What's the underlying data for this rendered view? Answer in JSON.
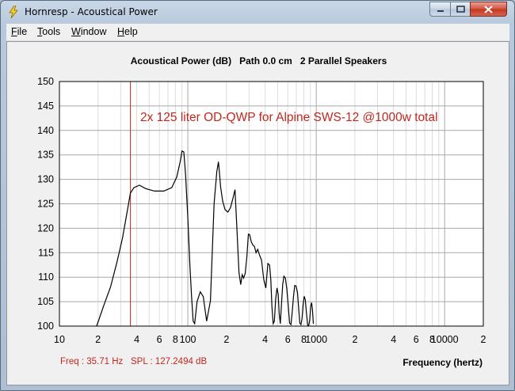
{
  "window": {
    "title": "Hornresp - Acoustical Power",
    "controls": {
      "minimize": "minimize-icon",
      "maximize": "maximize-icon",
      "close": "close-icon"
    }
  },
  "menu": {
    "file": "File",
    "tools": "Tools",
    "window": "Window",
    "help": "Help"
  },
  "header": {
    "quantity": "Acoustical Power (dB)",
    "path": "Path 0.0 cm",
    "speakers": "2 Parallel Speakers"
  },
  "annotation": "2x 125 liter OD-QWP for Alpine SWS-12 @1000w total",
  "status": {
    "freq": "Freq : 35.71 Hz",
    "spl": "SPL : 127.2494 dB",
    "x_axis_label": "Frequency (hertz)"
  },
  "colors": {
    "curve": "#000000",
    "cursor": "#c0281e",
    "annotation": "#c0281e",
    "grid_minor": "#dcdcdc",
    "grid_major": "#a8a8a8"
  },
  "chart_data": {
    "type": "line",
    "xscale": "log",
    "xlim": [
      10,
      20000
    ],
    "ylim": [
      100,
      150
    ],
    "y_ticks": [
      "150",
      "145",
      "140",
      "135",
      "130",
      "125",
      "120",
      "115",
      "110",
      "105",
      "100"
    ],
    "x_ticks": [
      {
        "f": 10,
        "label": "10"
      },
      {
        "f": 20,
        "label": "2"
      },
      {
        "f": 40,
        "label": "4"
      },
      {
        "f": 60,
        "label": "6"
      },
      {
        "f": 80,
        "label": "8"
      },
      {
        "f": 100,
        "label": "100"
      },
      {
        "f": 200,
        "label": "2"
      },
      {
        "f": 400,
        "label": "4"
      },
      {
        "f": 600,
        "label": "6"
      },
      {
        "f": 800,
        "label": "8"
      },
      {
        "f": 1000,
        "label": "1000"
      },
      {
        "f": 2000,
        "label": "2"
      },
      {
        "f": 4000,
        "label": "4"
      },
      {
        "f": 6000,
        "label": "6"
      },
      {
        "f": 8000,
        "label": "8"
      },
      {
        "f": 10000,
        "label": "10000"
      },
      {
        "f": 20000,
        "label": "2"
      }
    ],
    "cursor": {
      "freq": 35.71,
      "spl": 127.2494
    },
    "series": [
      {
        "x": [
          19.5,
          22,
          25,
          28,
          31,
          33,
          35.7,
          38,
          42,
          47,
          55,
          65,
          75,
          82,
          87,
          90,
          93,
          96,
          100,
          104,
          107,
          110,
          113,
          118,
          125,
          132,
          140,
          150,
          160,
          168,
          173,
          176,
          180,
          187,
          195,
          205,
          215,
          225,
          233,
          240,
          250,
          258,
          265,
          272,
          280,
          288,
          296,
          303,
          312,
          322,
          330,
          340,
          350,
          362,
          375,
          390,
          405,
          420,
          433,
          443,
          452,
          462,
          472,
          483,
          495,
          505,
          515,
          525,
          535,
          548,
          560,
          575,
          590,
          605,
          620,
          635,
          650,
          665,
          680,
          697,
          715,
          730,
          745,
          760,
          775,
          790,
          805,
          822,
          840,
          857,
          873,
          890,
          905,
          920,
          935,
          950
        ],
        "y": [
          100,
          104,
          108,
          113,
          118,
          122,
          127.2,
          128.3,
          128.8,
          128.1,
          127.6,
          127.6,
          128.3,
          130.5,
          133.5,
          135.8,
          135.6,
          131,
          122,
          112,
          106,
          101,
          100.5,
          105,
          107,
          106,
          101,
          105.2,
          125,
          131.5,
          133.6,
          131.5,
          128.5,
          125.5,
          123.8,
          123.3,
          124.2,
          126.2,
          127.9,
          121,
          111,
          108.5,
          110.5,
          109.8,
          110.8,
          114,
          118.8,
          118.7,
          117.2,
          116.5,
          116.3,
          115,
          115.7,
          114.5,
          113.5,
          109.5,
          107.8,
          112.8,
          112.5,
          109.5,
          104,
          100.5,
          101,
          105.5,
          107.8,
          106.5,
          102.5,
          100.5,
          104,
          108.5,
          110.2,
          109.8,
          107.6,
          104.2,
          100.6,
          100.3,
          102.8,
          106,
          108.3,
          108.2,
          106.8,
          103.5,
          100.6,
          100.3,
          101.5,
          104.3,
          106.1,
          105.4,
          102.5,
          100.2,
          100.1,
          101.2,
          104,
          104.8,
          103.2,
          100.5
        ]
      }
    ]
  }
}
